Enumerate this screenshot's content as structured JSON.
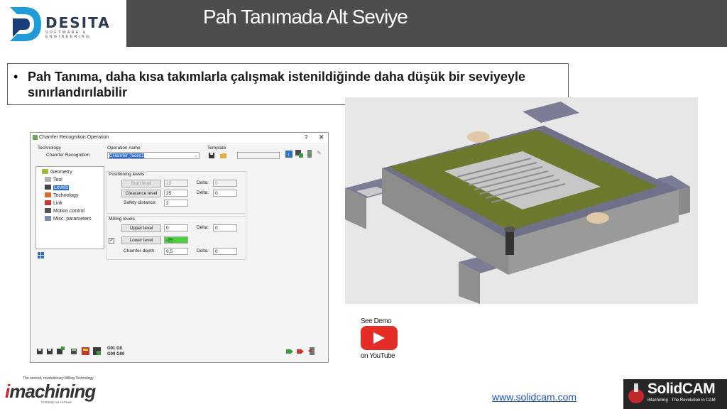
{
  "header": {
    "logo_text": "DESITA",
    "logo_subtext": "SOFTWARE & ENGINEERING",
    "title": "Pah Tanımada Alt Seviye"
  },
  "bullet": {
    "text": "Pah Tanıma, daha kısa takımlarla çalışmak istenildiğinde daha düşük bir seviyeyle sınırlandırılabilir"
  },
  "dialog": {
    "title": "Chamfer Recognition Operation",
    "help": "?",
    "close": "✕",
    "technology_label": "Technology",
    "technology_value": "Chamfer Recognition",
    "operation_name_label": "Operation name",
    "operation_name_value": "CHamfer_faces1",
    "template_label": "Template",
    "tree": [
      "Geometry",
      "Tool",
      "Levels",
      "Technology",
      "Link",
      "Motion control",
      "Misc. parameters"
    ],
    "selected_tree_item": "Levels",
    "positioning_group": "Positioning levels",
    "start_level_button": "Start level",
    "start_level_value": "25",
    "start_delta_label": "Delta:",
    "start_delta_value": "0",
    "clearance_level_button": "Clearance level",
    "clearance_level_value": "25",
    "clearance_delta_label": "Delta:",
    "clearance_delta_value": "0",
    "safety_distance_label": "Safety distance:",
    "safety_distance_value": "2",
    "milling_group": "Milling levels",
    "upper_level_button": "Upper level",
    "upper_level_value": "0",
    "upper_delta_label": "Delta:",
    "upper_delta_value": "0",
    "lower_level_button": "Lower level",
    "lower_level_value": "-15",
    "lower_checkbox_checked": "✓",
    "chamfer_depth_label": "Chamfer depth:",
    "chamfer_depth_value": "0,5",
    "chamfer_delta_label": "Delta:",
    "chamfer_delta_value": "0",
    "gcode_top": "G01  G0",
    "gcode_bottom": "G00  G00"
  },
  "youtube": {
    "see_demo": "See Demo",
    "on_youtube": "on YouTube"
  },
  "footer": {
    "imachining_tagline": "The second, revolutionary Milling Technology",
    "imachining_logo_i": "i",
    "imachining_logo_rest": "machining",
    "imachining_sub": "Certainly not Hi-Feed",
    "url": "www.solidcam.com",
    "solidcam_name": "SolidCAM",
    "solidcam_tag": "iMachining · The Revolution in CAM"
  },
  "colors": {
    "topbar": "#4d4d4d",
    "youtube_red": "#e52d27",
    "link_blue": "#1f4fd6",
    "lower_level_highlight": "#4ccf3f"
  }
}
